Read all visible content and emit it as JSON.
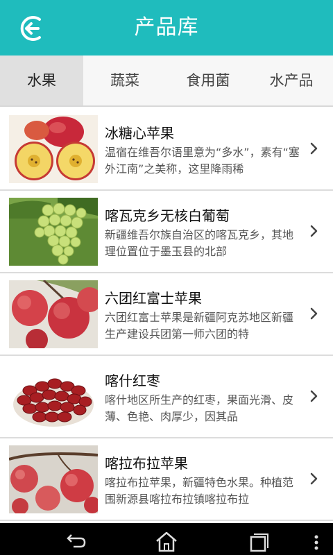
{
  "header": {
    "title": "产品库",
    "back_icon": "back-arrow-circle-icon"
  },
  "tabs": [
    {
      "label": "水果",
      "active": true
    },
    {
      "label": "蔬菜",
      "active": false
    },
    {
      "label": "食用菌",
      "active": false
    },
    {
      "label": "水产品",
      "active": false
    }
  ],
  "items": [
    {
      "title": "冰糖心苹果",
      "desc": "温宿在维吾尔语里意为“多水”，素有“塞外江南”之美称，这里降雨稀",
      "image": "apple-halves"
    },
    {
      "title": "喀瓦克乡无核白葡萄",
      "desc": "新疆维吾尔族自治区的喀瓦克乡，其地理位置位于墨玉县的北部",
      "image": "green-grapes"
    },
    {
      "title": "六团红富士苹果",
      "desc": "六团红富士苹果是新疆阿克苏地区新疆生产建设兵团第一师六团的特",
      "image": "red-apples-tree"
    },
    {
      "title": "喀什红枣",
      "desc": "喀什地区所生产的红枣，果面光滑、皮薄、色艳、肉厚少，因其品",
      "image": "red-dates-bowl"
    },
    {
      "title": "喀拉布拉苹果",
      "desc": "喀拉布拉苹果，新疆特色水果。种植范围新源县喀拉布拉镇喀拉布拉",
      "image": "apples-branch"
    }
  ],
  "navbar": {
    "back_icon": "nav-back-icon",
    "home_icon": "nav-home-icon",
    "recents_icon": "nav-recents-icon",
    "menu_icon": "overflow-menu-icon"
  },
  "colors": {
    "header": "#1fbcbd",
    "active_tab": "#e0e0e0",
    "navbar": "#000000"
  }
}
